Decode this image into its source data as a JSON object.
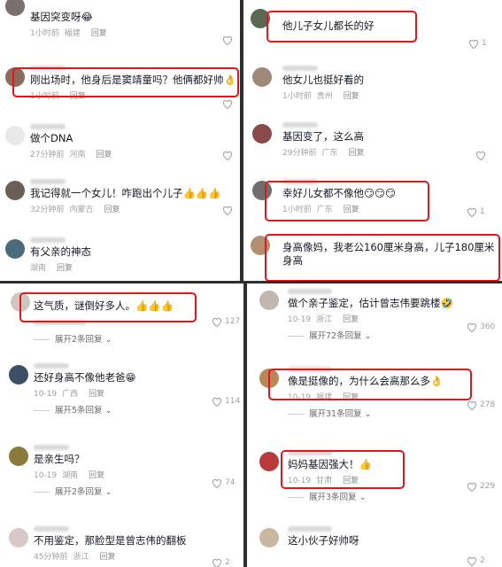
{
  "tl": [
    {
      "text": "基因突变呀😂",
      "time": "1小时前",
      "loc": "福建",
      "reply": "回复"
    },
    {
      "text": "刚出场时，他身后是窦靖童吗？他俩都好帅👌",
      "time": "1小时前",
      "loc": "",
      "reply": "回复"
    },
    {
      "text": "做个DNA",
      "time": "27分钟前",
      "loc": "河南",
      "reply": "回复"
    },
    {
      "text": "我记得就一个女儿！咋跑出个儿子👍👍👍",
      "time": "32分钟前",
      "loc": "内蒙古",
      "reply": "回复"
    },
    {
      "text": "有父亲的神态",
      "time": "",
      "loc": "湖南",
      "reply": "回复"
    }
  ],
  "tr": [
    {
      "text": "他儿子女儿都长的好",
      "time": "",
      "loc": "",
      "reply": "回复",
      "likes": "1"
    },
    {
      "text": "他女儿也挺好看的",
      "time": "1小时前",
      "loc": "贵州",
      "reply": "回复"
    },
    {
      "text": "基因变了，这么高",
      "time": "29分钟前",
      "loc": "广东",
      "reply": "回复"
    },
    {
      "text": "幸好儿女都不像他😏😏😏",
      "time": "1小时前",
      "loc": "广东",
      "reply": "回复",
      "likes": "1"
    },
    {
      "text": "身高像妈，我老公160厘米身高，儿子180厘米身高"
    }
  ],
  "bl": [
    {
      "text": "这气质，谜倒好多人。👍👍👍",
      "time": "",
      "loc": "",
      "reply": "",
      "likes": "127",
      "expand": "展开2条回复"
    },
    {
      "text": "还好身高不像他老爸😁",
      "time": "10-19",
      "loc": "广西",
      "reply": "回复",
      "likes": "114",
      "expand": "展开5条回复"
    },
    {
      "text": "是亲生吗？",
      "time": "10-19",
      "loc": "湖南",
      "reply": "回复",
      "likes": "74",
      "expand": "展开2条回复"
    },
    {
      "text": "不用鉴定，那脸型是曾志伟的翻板",
      "time": "45分钟前",
      "loc": "浙江",
      "reply": "回复",
      "likes": "2"
    }
  ],
  "br": [
    {
      "text": "做个亲子鉴定，估计曾志伟要跳楼🤣",
      "time": "10-19",
      "loc": "浙江",
      "reply": "回复",
      "likes": "360",
      "expand": "展开72条回复"
    },
    {
      "text": "像是挺像的，为什么会高那么多👌",
      "time": "10-19",
      "loc": "福建",
      "reply": "回复",
      "likes": "278",
      "expand": "展开31条回复"
    },
    {
      "text": "妈妈基因强大！👍",
      "time": "10-19",
      "loc": "甘肃",
      "reply": "回复",
      "likes": "229",
      "expand": "展开3条回复"
    },
    {
      "text": "这小伙子好帅呀",
      "time": "",
      "loc": "",
      "reply": "",
      "likes": "2"
    }
  ],
  "colors": {
    "highlight": "#e3161c",
    "text": "#161823",
    "meta": "#a0a0a5",
    "divider": "#2e2e2e"
  },
  "icons": {
    "like": "heart-outline-icon",
    "expand": "chevron-down-icon"
  }
}
